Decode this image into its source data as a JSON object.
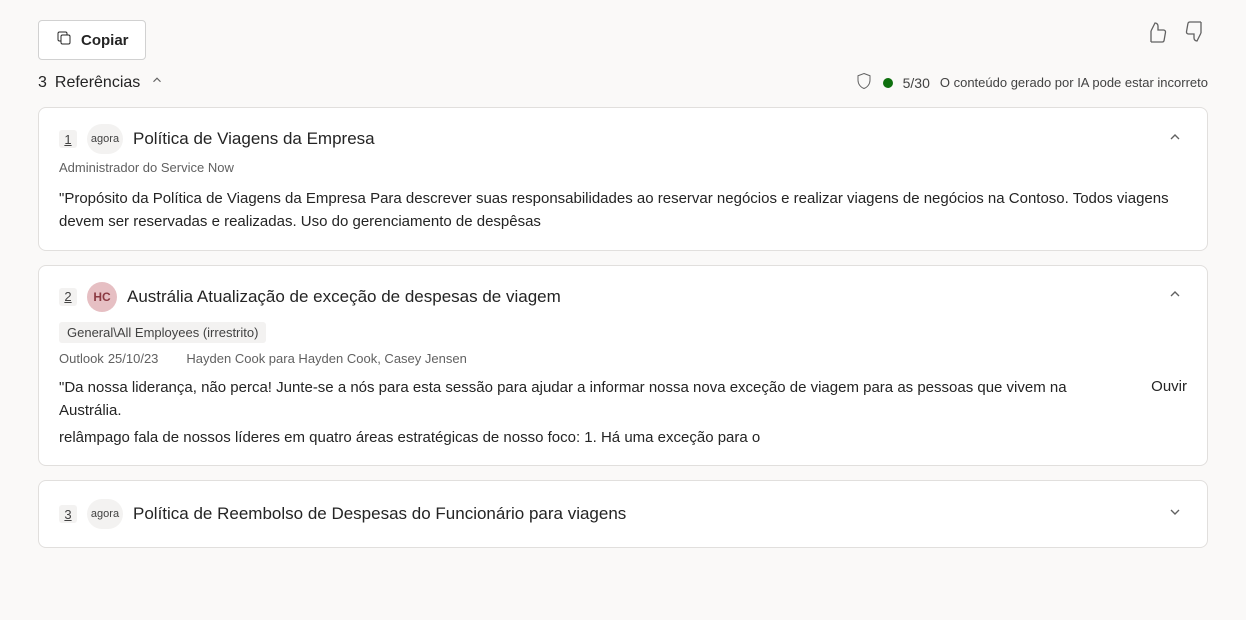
{
  "toolbar": {
    "copy_label": "Copiar"
  },
  "status": {
    "shield": "shield",
    "counter": "5/30",
    "disclaimer": "O conteúdo gerado por IA pode estar incorreto"
  },
  "references": {
    "count": "3",
    "label": "Referências",
    "items": [
      {
        "index": "1",
        "source_badge": "agora",
        "source_avatar": null,
        "title": "Política de Viagens da Empresa",
        "subheader": "Administrador do Service Now",
        "tag": null,
        "meta_app": null,
        "meta_date": null,
        "meta_from": null,
        "body": "\"Propósito da Política de Viagens da Empresa Para descrever suas responsabilidades ao reservar negócios e realizar viagens de negócios na Contoso. Todos viagens devem ser reservadas e realizadas. Uso do gerenciamento de despêsas",
        "body_line2": null,
        "listen": null,
        "expanded": true
      },
      {
        "index": "2",
        "source_badge": null,
        "source_avatar": "HC",
        "title": "Austrália Atualização de exceção de despesas de viagem",
        "subheader": null,
        "tag": "General\\All Employees (irrestrito)",
        "meta_app": "Outlook",
        "meta_date": "25/10/23",
        "meta_from": "Hayden Cook para Hayden Cook, Casey Jensen",
        "body": "\"Da nossa liderança, não perca! Junte-se a nós para esta sessão para ajudar a informar nossa nova exceção de viagem para as pessoas que vivem na Austrália.",
        "body_line2": "relâmpago fala de nossos líderes em quatro áreas estratégicas de nosso foco: 1. Há uma exceção para o",
        "listen": "Ouvir",
        "expanded": true
      },
      {
        "index": "3",
        "source_badge": "agora",
        "source_avatar": null,
        "title": "Política de Reembolso de Despesas do Funcionário para viagens",
        "subheader": null,
        "tag": null,
        "meta_app": null,
        "meta_date": null,
        "meta_from": null,
        "body": null,
        "body_line2": null,
        "listen": null,
        "expanded": false
      }
    ]
  }
}
